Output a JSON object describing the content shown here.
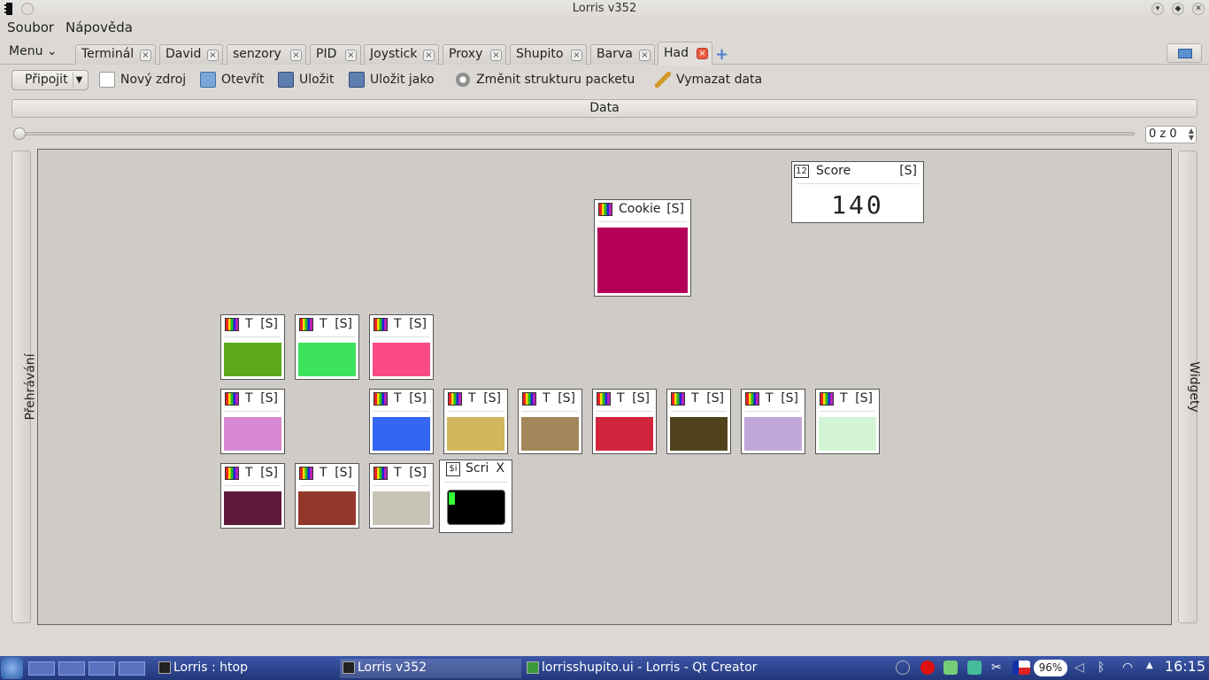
{
  "window": {
    "title": "Lorris v352"
  },
  "menubar": {
    "file": "Soubor",
    "help": "Nápověda"
  },
  "tabs": {
    "menu_label": "Menu",
    "items": [
      {
        "label": "Terminál"
      },
      {
        "label": "David"
      },
      {
        "label": "senzory"
      },
      {
        "label": "PID"
      },
      {
        "label": "Joystick"
      },
      {
        "label": "Proxy"
      },
      {
        "label": "Shupito"
      },
      {
        "label": "Barva"
      },
      {
        "label": "Had"
      }
    ],
    "add_symbol": "+",
    "close_symbol": "×"
  },
  "toolbar": {
    "connect": "Připojit",
    "new_source": "Nový zdroj",
    "open": "Otevřít",
    "save": "Uložit",
    "save_as": "Uložit jako",
    "change_struct": "Změnit strukturu packetu",
    "clear": "Vymazat data"
  },
  "data_bar": "Data",
  "playback": {
    "position": "0 z 0"
  },
  "side_panels": {
    "left": "Přehrávání",
    "right": "Widgety"
  },
  "widgets": {
    "cookie": {
      "name": "Cookie",
      "flag": "[S]",
      "color": "#b5005a"
    },
    "score": {
      "icon_text": "12",
      "name": "Score",
      "flag": "[S]",
      "value": "140"
    },
    "script": {
      "icon_text": "$i",
      "name": "Scri",
      "close": "X",
      "colors": {
        "bg": "#000000",
        "dot": "#33ff33"
      }
    },
    "tiles": [
      {
        "name": "T",
        "flag": "[S]",
        "color": "#5caa1c"
      },
      {
        "name": "T",
        "flag": "[S]",
        "color": "#3de35c"
      },
      {
        "name": "T",
        "flag": "[S]",
        "color": "#f94a87"
      },
      {
        "name": "T",
        "flag": "[S]",
        "color": "#d789d1"
      },
      {
        "name": "T",
        "flag": "[S]",
        "color": "#3466f2"
      },
      {
        "name": "T",
        "flag": "[S]",
        "color": "#d4b65e"
      },
      {
        "name": "T",
        "flag": "[S]",
        "color": "#a3875b"
      },
      {
        "name": "T",
        "flag": "[S]",
        "color": "#d0253d"
      },
      {
        "name": "T",
        "flag": "[S]",
        "color": "#51431e"
      },
      {
        "name": "T",
        "flag": "[S]",
        "color": "#c2a8da"
      },
      {
        "name": "T",
        "flag": "[S]",
        "color": "#d3f5d5"
      },
      {
        "name": "T",
        "flag": "[S]",
        "color": "#5e1a3c"
      },
      {
        "name": "T",
        "flag": "[S]",
        "color": "#93372b"
      },
      {
        "name": "T",
        "flag": "[S]",
        "color": "#c8c4b5"
      }
    ]
  },
  "taskbar": {
    "tasks": [
      {
        "label": "Lorris : htop"
      },
      {
        "label": "Lorris v352"
      },
      {
        "label": "lorrisshupito.ui - Lorris - Qt Creator"
      }
    ],
    "battery": "96%",
    "clock": "16:15"
  }
}
